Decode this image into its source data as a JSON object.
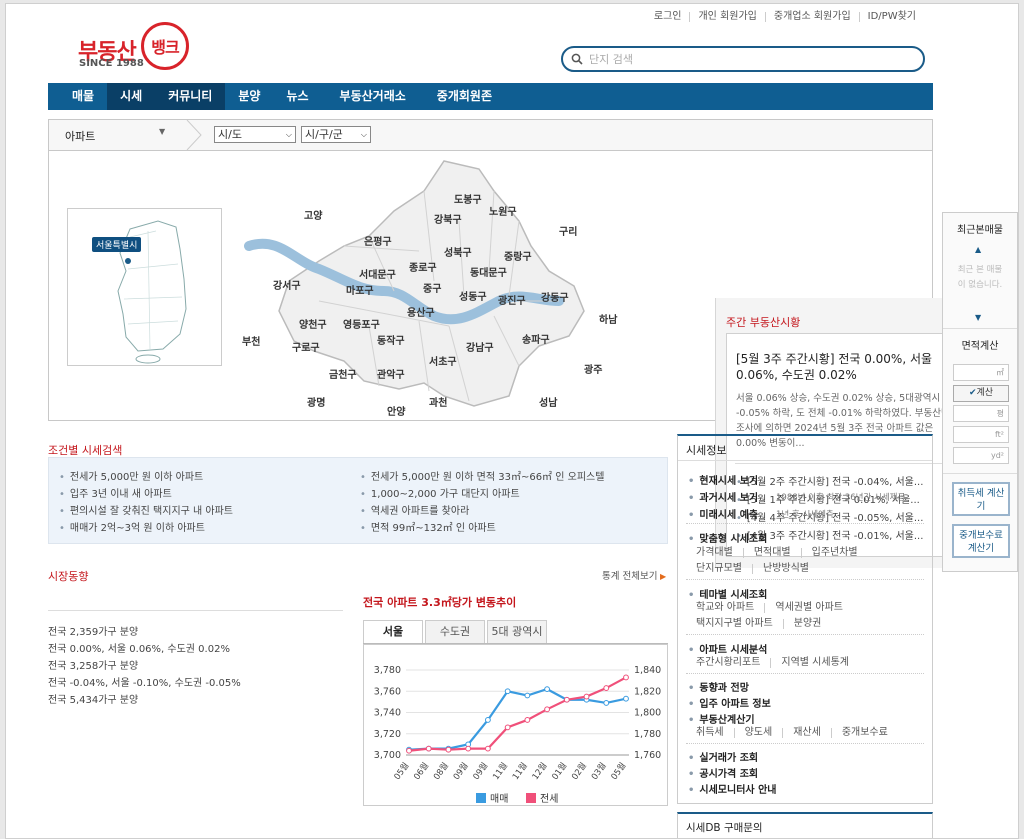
{
  "toplinks": [
    "로그인",
    "개인 회원가입",
    "중개업소 회원가입",
    "ID/PW찾기"
  ],
  "logo": {
    "main": "부동산",
    "circle": "뱅크",
    "since": "SINCE 1988"
  },
  "search": {
    "placeholder": "단지 검색"
  },
  "nav": [
    "매물",
    "시세",
    "커뮤니티",
    "분양",
    "뉴스",
    "부동산거래소",
    "중개회원존"
  ],
  "filter": {
    "type": "아파트",
    "sido": "시/도",
    "sigungu": "시/구/군"
  },
  "map": {
    "region_tag": "서울특별시",
    "districts": [
      "도봉구",
      "노원구",
      "강북구",
      "은평구",
      "성북구",
      "중랑구",
      "종로구",
      "서대문구",
      "동대문구",
      "마포구",
      "중구",
      "강서구",
      "성동구",
      "광진구",
      "강동구",
      "용산구",
      "양천구",
      "영등포구",
      "동작구",
      "강남구",
      "송파구",
      "구로구",
      "서초구",
      "금천구",
      "관악구"
    ],
    "outer": [
      "고양",
      "구리",
      "하남",
      "부천",
      "광명",
      "안양",
      "과천",
      "성남",
      "광주"
    ]
  },
  "weekly": {
    "title": "주간 부동산시황",
    "headline": "[5월 3주 주간시황] 전국 0.00%, 서울 0.06%, 수도권 0.02%",
    "body": "서울 0.06% 상승, 수도권 0.02% 상승, 5대광역시 -0.05% 하락, 도 전체 -0.01% 하락하였다. 부동산뱅크 조사에 의하면 2024년 5월 3주 전국 아파트 값은 0.00% 변동이...",
    "items": [
      "[5월 2주 주간시황] 전국 -0.04%, 서울...",
      "[5월 1주 주간시황] 전국 0.01%, 서울...",
      "[4월 4주 주간시황] 전국 -0.05%, 서울...",
      "[4월 3주 주간시황] 전국 -0.01%, 서울..."
    ]
  },
  "cond": {
    "title": "조건별 시세검색",
    "items": [
      "전세가 5,000만 원 이하 아파트",
      "입주 3년 이내 새 아파트",
      "편의시설 잘 갖춰진 택지지구 내 아파트",
      "매매가 2억~3억 원 이하 아파트",
      "전세가 5,000만 원 이하 면적 33㎡~66㎡ 인 오피스텔",
      "1,000~2,000 가구 대단지 아파트",
      "역세권 아파트를 찾아라",
      "면적 99㎡~132㎡ 인 아파트"
    ]
  },
  "market": {
    "title": "시장동향",
    "stats_link": "통계 전체보기",
    "items": [
      "전국 2,359가구 분양",
      "전국 0.00%, 서울 0.06%, 수도권 0.02%",
      "전국 3,258가구 분양",
      "전국 -0.04%, 서울 -0.10%, 수도권 -0.05%",
      "전국 5,434가구 분양"
    ]
  },
  "chart_title": "전국 아파트 3.3㎡당가 변동추이",
  "chart_tabs": [
    "서울",
    "수도권",
    "5대 광역시"
  ],
  "chart_data": {
    "type": "line",
    "x": [
      "05월",
      "06월",
      "08월",
      "09월",
      "09월",
      "11월",
      "11월",
      "12월",
      "01월",
      "02월",
      "03월",
      "05월"
    ],
    "left_axis": {
      "ticks": [
        "3,700",
        "3,720",
        "3,740",
        "3,760",
        "3,780"
      ],
      "ylim": [
        3700,
        3780
      ]
    },
    "right_axis": {
      "ticks": [
        "1,760",
        "1,780",
        "1,800",
        "1,820",
        "1,840"
      ],
      "ylim": [
        1760,
        1840
      ]
    },
    "series": [
      {
        "name": "매매",
        "axis": "left",
        "color": "#3a9be0",
        "values": [
          3705,
          3706,
          3706,
          3710,
          3733,
          3760,
          3756,
          3762,
          3752,
          3752,
          3749,
          3753
        ]
      },
      {
        "name": "전세",
        "axis": "right",
        "color": "#f0507a",
        "values": [
          1764,
          1766,
          1765,
          1766,
          1766,
          1786,
          1793,
          1803,
          1812,
          1815,
          1823,
          1833
        ]
      }
    ]
  },
  "info": {
    "title": "시세정보",
    "g1": [
      "현재시세 보기",
      "과거시세 보기",
      "미래시세 예측"
    ],
    "g1_notes": [
      "1988년 이후 최장 36년간 시세제공",
      "1년 후 시세예측"
    ],
    "g2_title": "맞춤형 시세조회",
    "g2": [
      "가격대별",
      "면적대별",
      "입주년차별",
      "단지규모별",
      "난방방식별"
    ],
    "g3_title": "테마별 시세조회",
    "g3": [
      "학교와 아파트",
      "역세권별 아파트",
      "택지지구별 아파트",
      "분양권"
    ],
    "g4_title": "아파트 시세분석",
    "g4": [
      "주간시황리포트",
      "지역별 시세통계"
    ],
    "g5": [
      "동향과 전망",
      "입주 아파트 정보",
      "부동산계산기"
    ],
    "g5_sub": [
      "취득세",
      "양도세",
      "재산세",
      "중개보수료"
    ],
    "g6": [
      "실거래가 조회",
      "공시가격 조회",
      "시세모니터사 안내"
    ],
    "db": "시세DB 구매문의"
  },
  "side": {
    "recent_title": "최근본매물",
    "recent_empty": "최근 본 매물이 없습니다.",
    "area_title": "면적계산",
    "unit_m2": "㎡",
    "calc": "계산",
    "unit_py": "평",
    "unit_ft": "ft²",
    "unit_yd": "yd²",
    "btn1": "취득세 계산기",
    "btn2": "중개보수료 계산기"
  },
  "colors": {
    "nav": "#0f5e92",
    "accent": "#c4161c"
  }
}
